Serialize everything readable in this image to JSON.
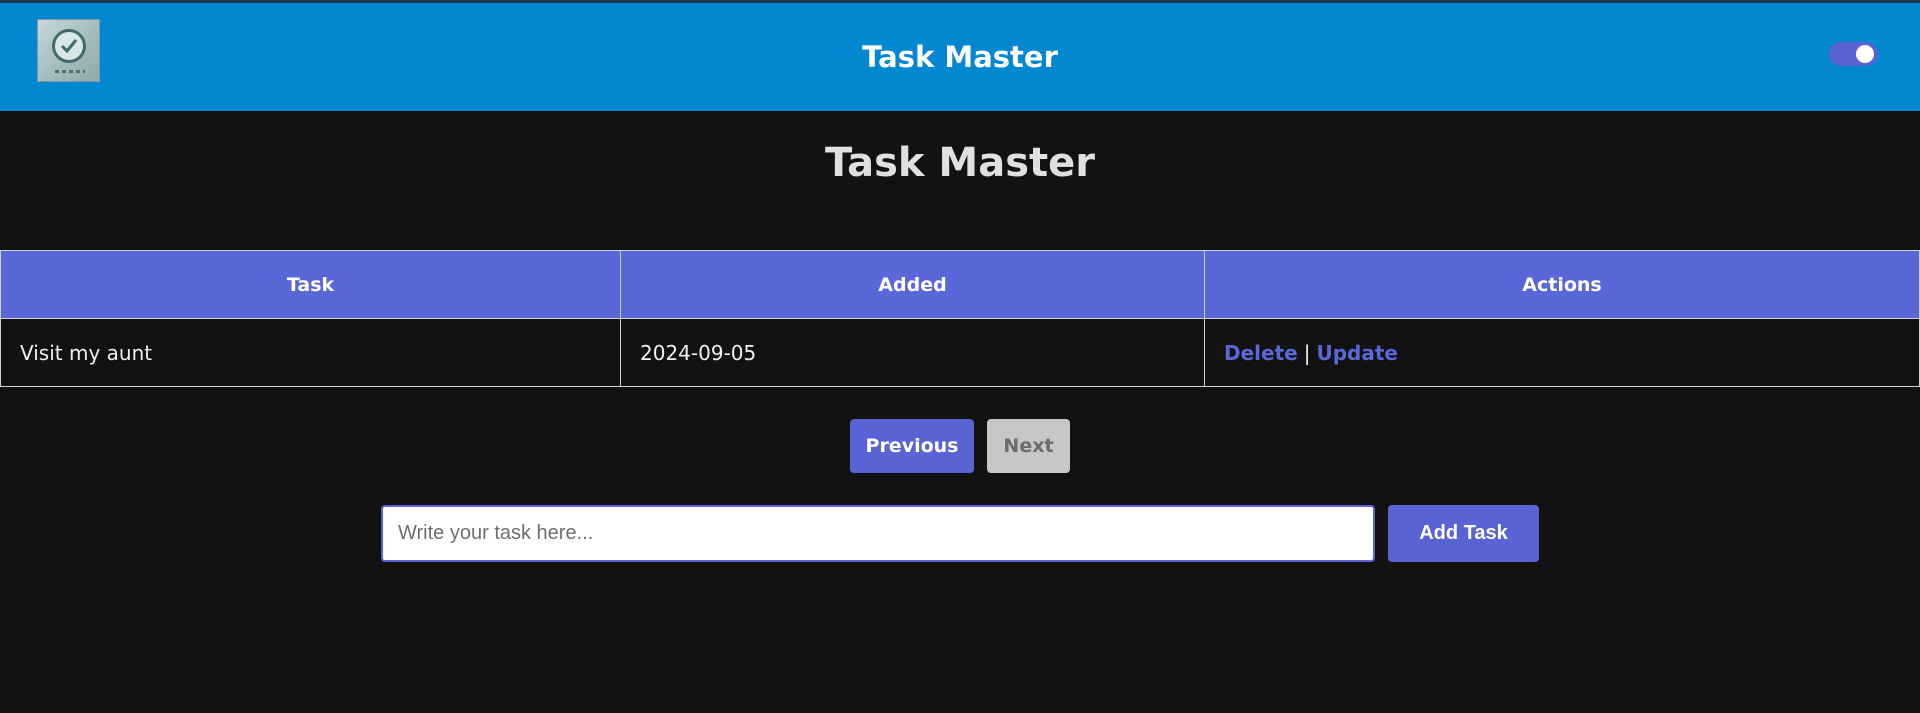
{
  "navbar": {
    "title": "Task Master",
    "logo_icon": "checklist-logo-icon",
    "toggle_on": true,
    "toggle_color": "#5a63d4",
    "background": "#0288d1"
  },
  "main": {
    "title": "Task Master"
  },
  "table": {
    "headers": [
      "Task",
      "Added",
      "Actions"
    ],
    "rows": [
      {
        "task": "Visit my aunt",
        "added": "2024-09-05",
        "delete_label": "Delete",
        "separator": "|",
        "update_label": "Update"
      }
    ],
    "header_color": "#5a67d8"
  },
  "pagination": {
    "previous_label": "Previous",
    "next_label": "Next"
  },
  "add_form": {
    "placeholder": "Write your task here...",
    "value": "",
    "button_label": "Add Task"
  },
  "colors": {
    "accent": "#5a63d4",
    "page_background": "#121212"
  }
}
